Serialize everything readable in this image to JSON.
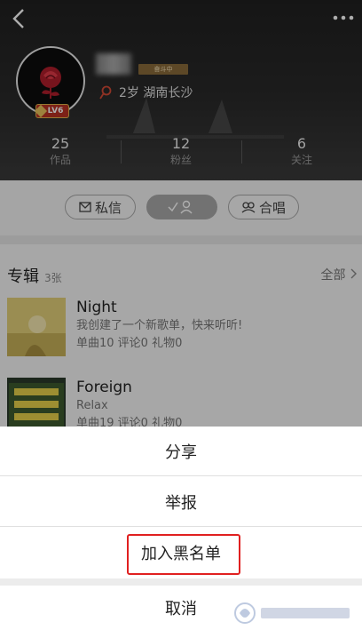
{
  "profile": {
    "level": "LV6",
    "status_badge": "奋斗中",
    "info": "2岁 湖南长沙"
  },
  "stats": [
    {
      "num": "25",
      "label": "作品"
    },
    {
      "num": "12",
      "label": "粉丝"
    },
    {
      "num": "6",
      "label": "关注"
    }
  ],
  "actions": {
    "message": "私信",
    "chorus": "合唱"
  },
  "albums": {
    "title": "专辑",
    "count": "3张",
    "all": "全部",
    "items": [
      {
        "name": "Night",
        "desc": "我创建了一个新歌单，快来听听!",
        "counts": "单曲10  评论0  礼物0"
      },
      {
        "name": "Foreign",
        "desc": "Relax",
        "counts": "单曲19  评论0  礼物0"
      }
    ]
  },
  "sheet": {
    "share": "分享",
    "report": "举报",
    "blacklist": "加入黑名单",
    "cancel": "取消"
  },
  "colors": {
    "highlight": "#e02020",
    "level_badge": "#b83222"
  }
}
